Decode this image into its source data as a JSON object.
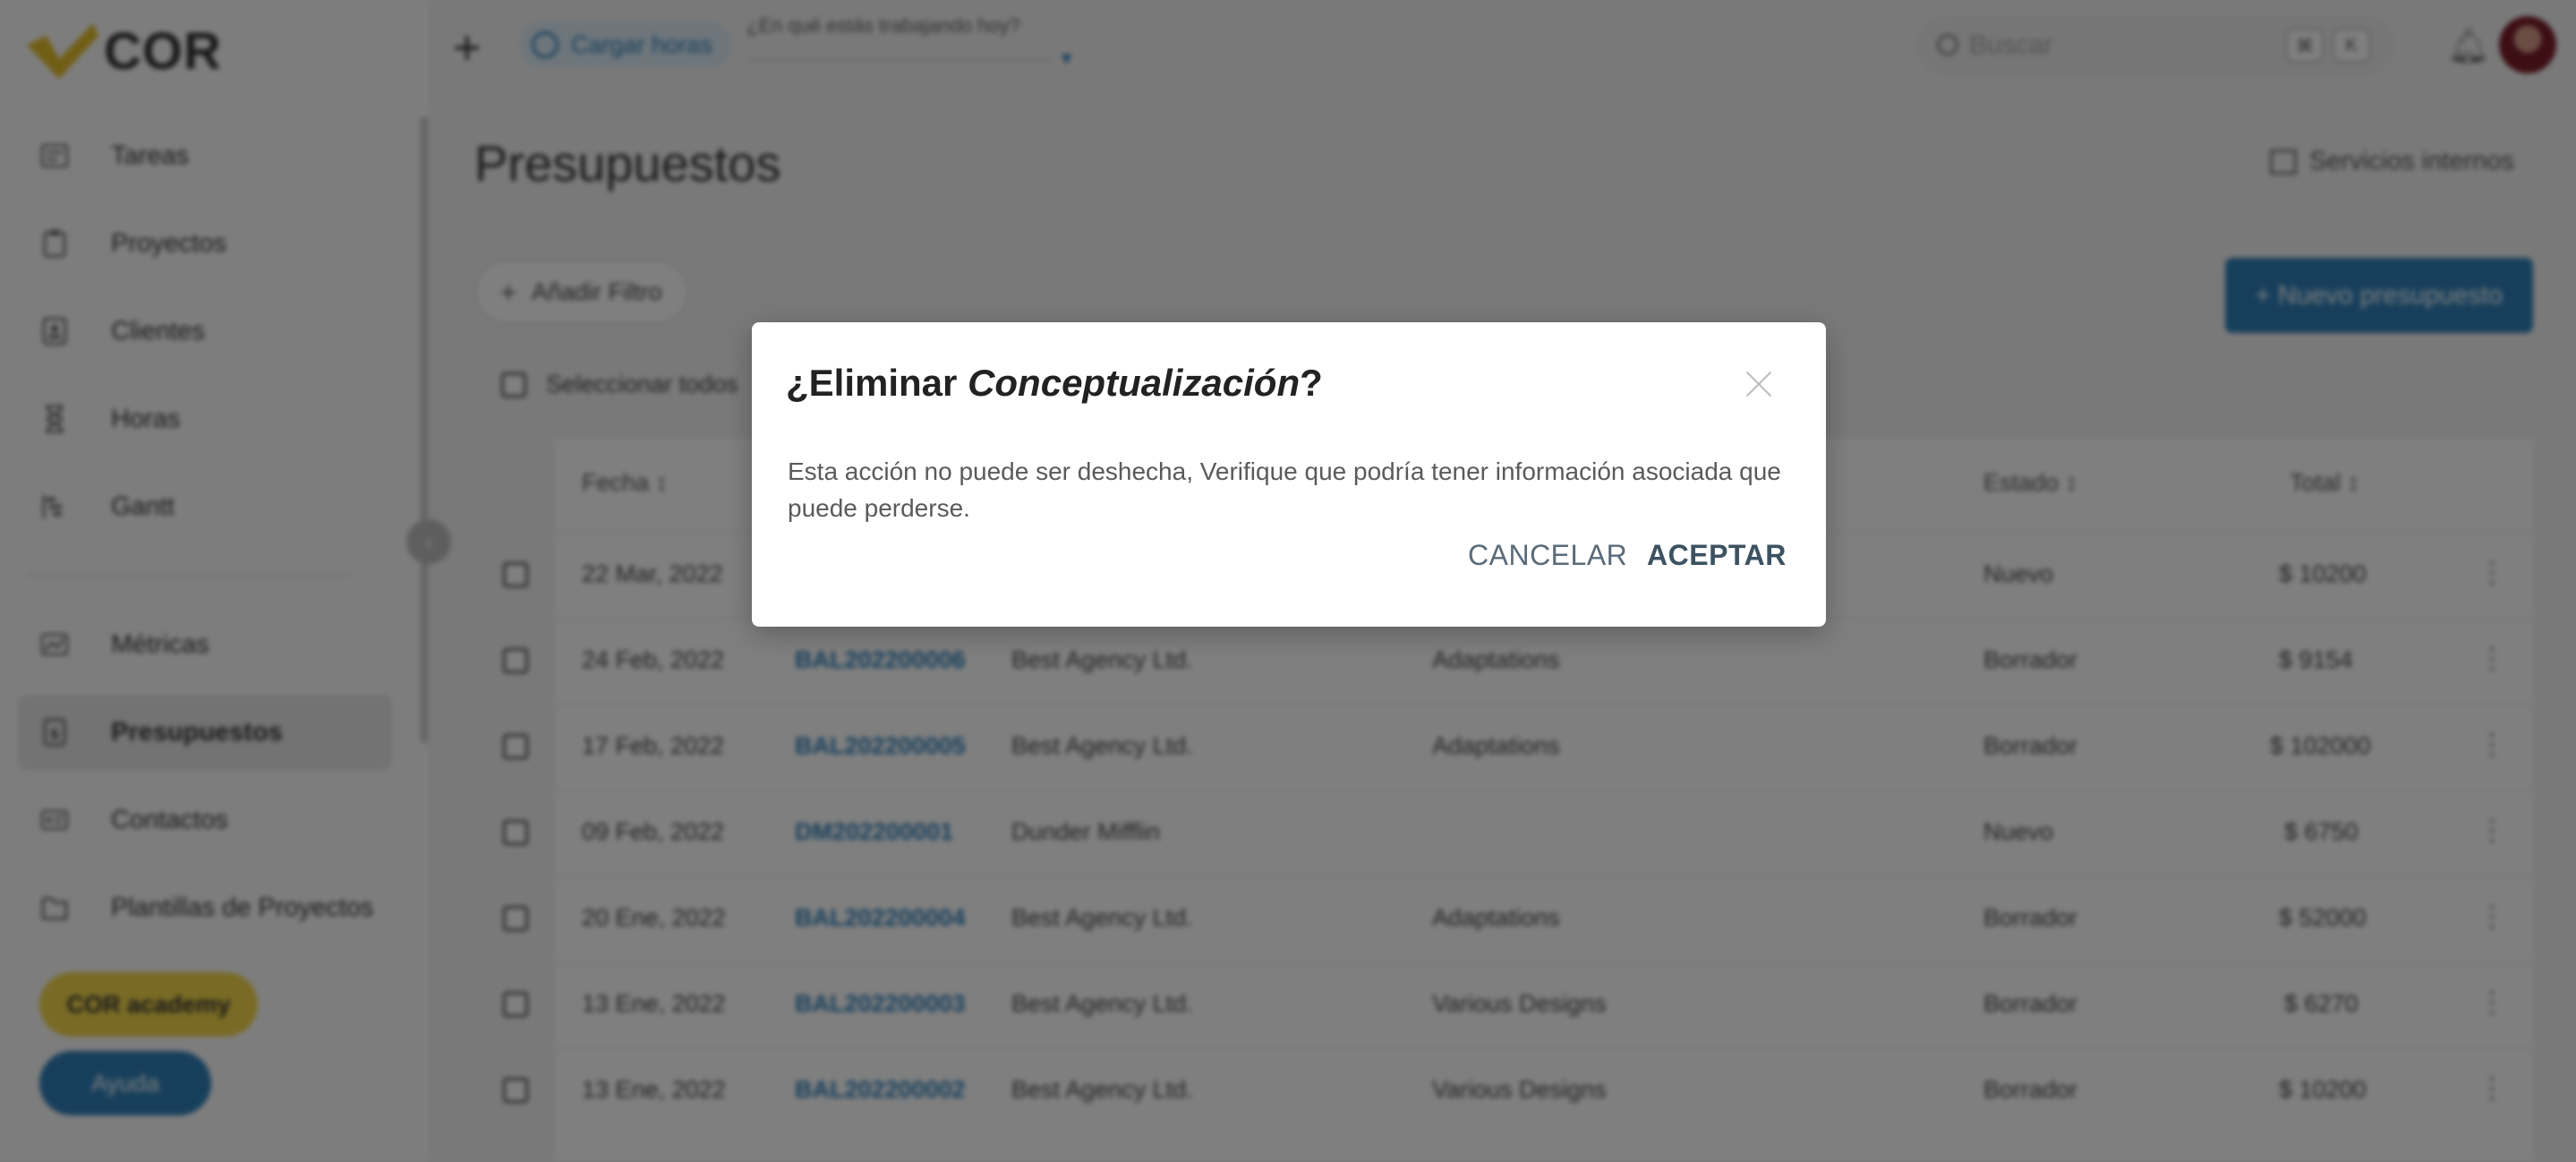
{
  "app": {
    "logo_text": "COR"
  },
  "sidebar": {
    "items": [
      {
        "label": "Tareas",
        "icon": "tasks-icon"
      },
      {
        "label": "Proyectos",
        "icon": "projects-icon"
      },
      {
        "label": "Clientes",
        "icon": "clients-icon"
      },
      {
        "label": "Horas",
        "icon": "hourglass-icon"
      },
      {
        "label": "Gantt",
        "icon": "gantt-icon"
      },
      {
        "label": "Métricas",
        "icon": "metrics-icon"
      },
      {
        "label": "Presupuestos",
        "icon": "budgets-icon",
        "active": true
      },
      {
        "label": "Contactos",
        "icon": "contacts-icon"
      },
      {
        "label": "Plantillas de Proyectos",
        "icon": "templates-icon"
      }
    ],
    "cor_button": "COR academy",
    "help_button": "Ayuda"
  },
  "topbar": {
    "cargar_horas": "Cargar horas",
    "working_placeholder": "¿En qué estás trabajando hoy?",
    "search_placeholder": "Buscar",
    "kbd_1": "⌘",
    "kbd_2": "K"
  },
  "main": {
    "title": "Presupuestos",
    "servicios": "Servicios internos",
    "add_filter": "Añadir Filtro",
    "new_budget": "+ Nuevo presupuesto",
    "select_all": "Seleccionar todos",
    "columns": {
      "fecha": "Fecha",
      "estado": "Estado",
      "total": "Total"
    },
    "rows": [
      {
        "fecha": "22 Mar, 2022",
        "code": "",
        "client": "",
        "project": "",
        "estado": "Nuevo",
        "total": "$ 10200"
      },
      {
        "fecha": "24 Feb, 2022",
        "code": "BAL202200006",
        "client": "Best Agency Ltd.",
        "project": "Adaptations",
        "estado": "Borrador",
        "total": "$ 9154"
      },
      {
        "fecha": "17 Feb, 2022",
        "code": "BAL202200005",
        "client": "Best Agency Ltd.",
        "project": "Adaptations",
        "estado": "Borrador",
        "total": "$ 102000"
      },
      {
        "fecha": "09 Feb, 2022",
        "code": "DM202200001",
        "client": "Dunder Mifflin",
        "project": "",
        "estado": "Nuevo",
        "total": "$ 6750"
      },
      {
        "fecha": "20 Ene, 2022",
        "code": "BAL202200004",
        "client": "Best Agency Ltd.",
        "project": "Adaptations",
        "estado": "Borrador",
        "total": "$ 52000"
      },
      {
        "fecha": "13 Ene, 2022",
        "code": "BAL202200003",
        "client": "Best Agency Ltd.",
        "project": "Various Designs",
        "estado": "Borrador",
        "total": "$ 6270"
      },
      {
        "fecha": "13 Ene, 2022",
        "code": "BAL202200002",
        "client": "Best Agency Ltd.",
        "project": "Various Designs",
        "estado": "Borrador",
        "total": "$ 10200"
      }
    ]
  },
  "modal": {
    "title_prefix": "¿Eliminar ",
    "title_item": "Conceptualización",
    "title_suffix": "?",
    "body": "Esta acción no puede ser deshecha, Verifique que podría tener información asociada que puede perderse.",
    "cancel": "CANCELAR",
    "accept": "ACEPTAR"
  },
  "colors": {
    "accent": "#2f7fb8",
    "brand_yellow": "#f2d64b",
    "overlay": "rgba(0,0,0,0.5)"
  }
}
